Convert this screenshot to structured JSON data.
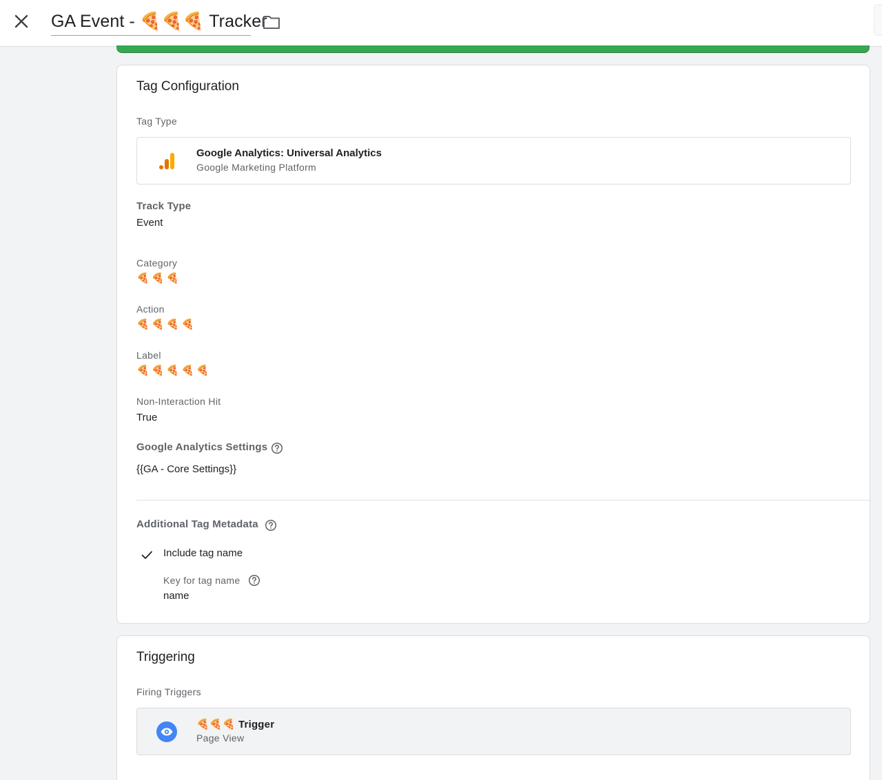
{
  "header": {
    "title": "GA Event - 🍕🍕🍕 Tracker"
  },
  "tag_config": {
    "title": "Tag Configuration",
    "tag_type_label": "Tag Type",
    "tag_type_name": "Google Analytics: Universal Analytics",
    "tag_type_sub": "Google Marketing Platform",
    "track_type_label": "Track Type",
    "track_type_value": "Event",
    "category_label": "Category",
    "category_value": "🍕🍕🍕",
    "action_label": "Action",
    "action_value": "🍕🍕🍕🍕",
    "label_label": "Label",
    "label_value": "🍕🍕🍕🍕🍕",
    "non_interaction_label": "Non-Interaction Hit",
    "non_interaction_value": "True",
    "ga_settings_label": "Google Analytics Settings",
    "ga_settings_value": "{{GA - Core Settings}}",
    "metadata_label": "Additional Tag Metadata",
    "include_tag_name_label": "Include tag name",
    "include_tag_name_checked": true,
    "key_label": "Key for tag name",
    "key_value": "name"
  },
  "triggering": {
    "title": "Triggering",
    "firing_label": "Firing Triggers",
    "trigger_name": "🍕🍕🍕 Trigger",
    "trigger_type": "Page View"
  },
  "colors": {
    "accent_green": "#34a853",
    "ga_orange": "#f9ab00",
    "ga_dark_orange": "#e37400",
    "trigger_blue": "#4285f4"
  },
  "icons": [
    "close-icon",
    "folder-icon",
    "google-analytics-icon",
    "help-icon",
    "check-icon",
    "eye-icon"
  ]
}
